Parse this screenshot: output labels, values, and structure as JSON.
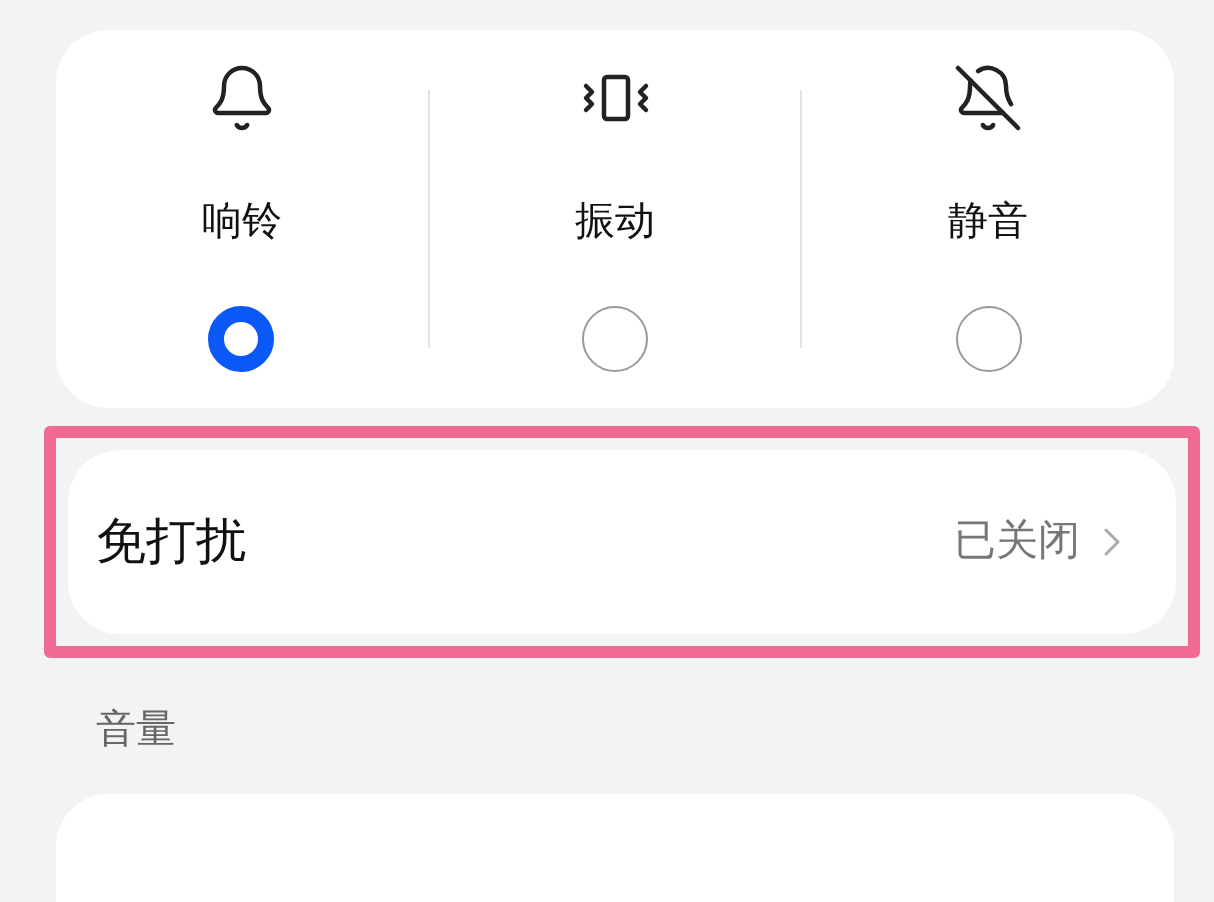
{
  "modes": [
    {
      "label": "响铃",
      "kind": "ring",
      "selected": true
    },
    {
      "label": "振动",
      "kind": "vibrate",
      "selected": false
    },
    {
      "label": "静音",
      "kind": "silent",
      "selected": false
    }
  ],
  "dnd": {
    "label": "免打扰",
    "value": "已关闭",
    "highlighted": true
  },
  "volume": {
    "title": "音量"
  }
}
